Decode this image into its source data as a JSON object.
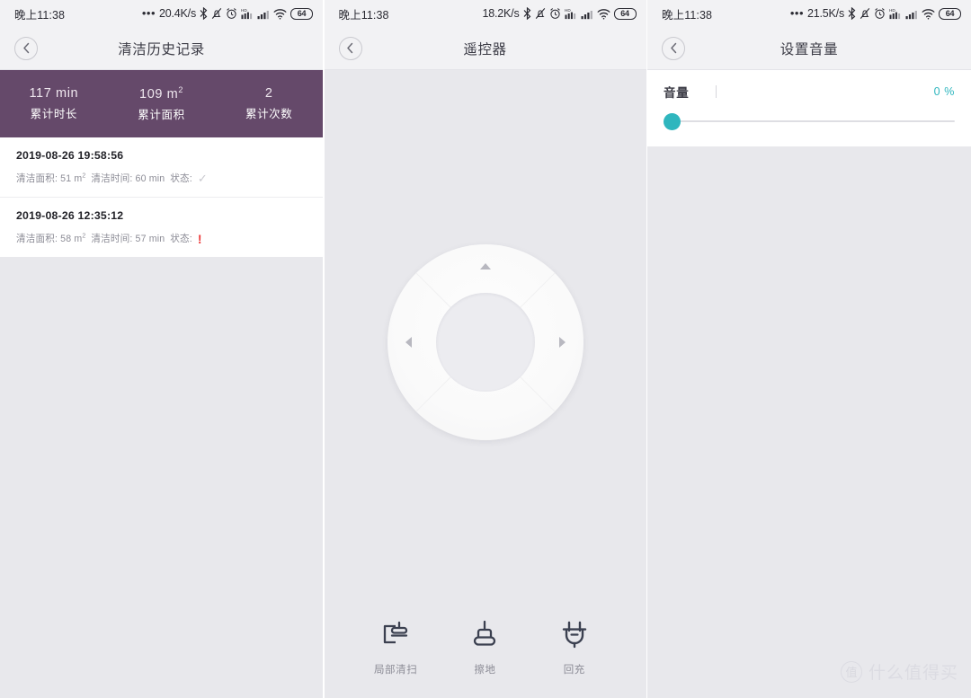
{
  "panels": [
    {
      "statusbar": {
        "time": "晚上11:38",
        "dots": "•••",
        "speed": "20.4K/s",
        "battery": "64",
        "icons": [
          "bluetooth-icon",
          "mute-bell-icon",
          "alarm-clock-icon",
          "hd-signal-icon",
          "signal-bars-icon",
          "wifi-icon",
          "battery-icon"
        ]
      },
      "title": "清洁历史记录",
      "back_icon": "chevron-left-icon",
      "accent_color": "#65496a",
      "stats": [
        {
          "value": "117  min",
          "unit": "",
          "label": "累计时长"
        },
        {
          "value": "109  m",
          "unit": "2",
          "label": "累计面积"
        },
        {
          "value": "2",
          "unit": "",
          "label": "累计次数"
        }
      ],
      "history": [
        {
          "date": "2019-08-26 19:58:56",
          "area_label": "清洁面积:",
          "area_value": "51 m",
          "area_unit": "2",
          "time_label": "清洁时间:",
          "time_value": "60 min",
          "status_label": "状态:",
          "status_icon": "check-mark-icon",
          "status_glyph": "✓",
          "status_color": "#c9c9cf"
        },
        {
          "date": "2019-08-26 12:35:12",
          "area_label": "清洁面积:",
          "area_value": "58 m",
          "area_unit": "2",
          "time_label": "清洁时间:",
          "time_value": "57 min",
          "status_label": "状态:",
          "status_icon": "warning-exclamation-icon",
          "status_glyph": "!",
          "status_color": "#ec3c3c"
        }
      ]
    },
    {
      "statusbar": {
        "time": "晚上11:38",
        "dots": "",
        "speed": "18.2K/s",
        "battery": "64"
      },
      "title": "遥控器",
      "back_icon": "chevron-left-icon",
      "dpad": {
        "up_icon": "arrow-up-icon",
        "left_icon": "arrow-left-icon",
        "right_icon": "arrow-right-icon",
        "down_icon": "dpad-down-segment"
      },
      "actions": [
        {
          "label": "局部清扫",
          "icon": "spot-clean-icon"
        },
        {
          "label": "擦地",
          "icon": "mop-icon"
        },
        {
          "label": "回充",
          "icon": "recharge-plug-icon"
        }
      ]
    },
    {
      "statusbar": {
        "time": "晚上11:38",
        "dots": "•••",
        "speed": "21.5K/s",
        "battery": "64"
      },
      "title": "设置音量",
      "back_icon": "chevron-left-icon",
      "volume": {
        "label": "音量",
        "percent": "0 %",
        "value": 0,
        "accent_color": "#2fb6be"
      }
    }
  ],
  "watermark": {
    "badge": "值",
    "text": "什么值得买"
  }
}
